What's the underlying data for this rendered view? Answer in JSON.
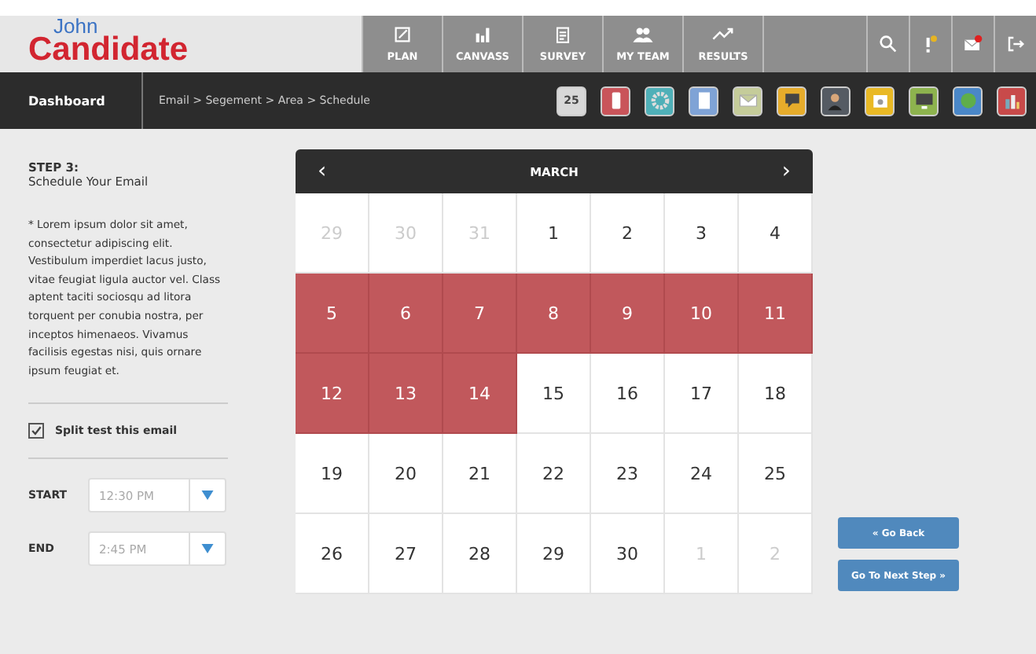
{
  "logo": {
    "first": "John",
    "last": "Candidate"
  },
  "nav": [
    {
      "kind": "plan",
      "label": "PLAN"
    },
    {
      "kind": "canvass",
      "label": "CANVASS"
    },
    {
      "kind": "survey",
      "label": "SURVEY"
    },
    {
      "kind": "team",
      "label": "MY TEAM"
    },
    {
      "kind": "results",
      "label": "RESULTS"
    }
  ],
  "header_icons": [
    {
      "kind": "search"
    },
    {
      "kind": "alert",
      "badge": true
    },
    {
      "kind": "mail",
      "badge": true
    },
    {
      "kind": "logout"
    }
  ],
  "dashboard": "Dashboard",
  "breadcrumb": "Email > Segement > Area > Schedule",
  "apps": [
    {
      "kind": "calendar",
      "label": "25"
    },
    {
      "kind": "phone"
    },
    {
      "kind": "gear"
    },
    {
      "kind": "document"
    },
    {
      "kind": "mail"
    },
    {
      "kind": "chat"
    },
    {
      "kind": "person"
    },
    {
      "kind": "window"
    },
    {
      "kind": "monitor"
    },
    {
      "kind": "globe"
    },
    {
      "kind": "chart"
    }
  ],
  "step": {
    "number": "STEP 3:",
    "title": "Schedule Your Email",
    "body": "* Lorem ipsum dolor sit amet, consectetur adipiscing elit. Vestibulum imperdiet lacus justo, vitae feugiat ligula auctor vel. Class aptent taciti sociosqu ad litora torquent per conubia nostra, per inceptos himenaeos. Vivamus facilisis egestas nisi, quis ornare ipsum feugiat et."
  },
  "split_test": {
    "label": "Split test this email",
    "checked": true
  },
  "times": [
    {
      "label": "START",
      "value": "12:30 PM"
    },
    {
      "label": "END",
      "value": "2:45 PM"
    }
  ],
  "calendar": {
    "month": "MARCH",
    "prev": "‹",
    "next": "›",
    "days": [
      {
        "day": "29",
        "muted": true,
        "selected": false
      },
      {
        "day": "30",
        "muted": true,
        "selected": false
      },
      {
        "day": "31",
        "muted": true,
        "selected": false
      },
      {
        "day": "1",
        "muted": false,
        "selected": false
      },
      {
        "day": "2",
        "muted": false,
        "selected": false
      },
      {
        "day": "3",
        "muted": false,
        "selected": false
      },
      {
        "day": "4",
        "muted": false,
        "selected": false
      },
      {
        "day": "5",
        "muted": false,
        "selected": true
      },
      {
        "day": "6",
        "muted": false,
        "selected": true
      },
      {
        "day": "7",
        "muted": false,
        "selected": true
      },
      {
        "day": "8",
        "muted": false,
        "selected": true
      },
      {
        "day": "9",
        "muted": false,
        "selected": true
      },
      {
        "day": "10",
        "muted": false,
        "selected": true
      },
      {
        "day": "11",
        "muted": false,
        "selected": true
      },
      {
        "day": "12",
        "muted": false,
        "selected": true
      },
      {
        "day": "13",
        "muted": false,
        "selected": true
      },
      {
        "day": "14",
        "muted": false,
        "selected": true
      },
      {
        "day": "15",
        "muted": false,
        "selected": false
      },
      {
        "day": "16",
        "muted": false,
        "selected": false
      },
      {
        "day": "17",
        "muted": false,
        "selected": false
      },
      {
        "day": "18",
        "muted": false,
        "selected": false
      },
      {
        "day": "19",
        "muted": false,
        "selected": false
      },
      {
        "day": "20",
        "muted": false,
        "selected": false
      },
      {
        "day": "21",
        "muted": false,
        "selected": false
      },
      {
        "day": "22",
        "muted": false,
        "selected": false
      },
      {
        "day": "23",
        "muted": false,
        "selected": false
      },
      {
        "day": "24",
        "muted": false,
        "selected": false
      },
      {
        "day": "25",
        "muted": false,
        "selected": false
      },
      {
        "day": "26",
        "muted": false,
        "selected": false
      },
      {
        "day": "27",
        "muted": false,
        "selected": false
      },
      {
        "day": "28",
        "muted": false,
        "selected": false
      },
      {
        "day": "29",
        "muted": false,
        "selected": false
      },
      {
        "day": "30",
        "muted": false,
        "selected": false
      },
      {
        "day": "1",
        "muted": true,
        "selected": false
      },
      {
        "day": "2",
        "muted": true,
        "selected": false
      }
    ]
  },
  "buttons": [
    {
      "label": "« Go Back"
    },
    {
      "label": "Go To Next Step »"
    }
  ]
}
